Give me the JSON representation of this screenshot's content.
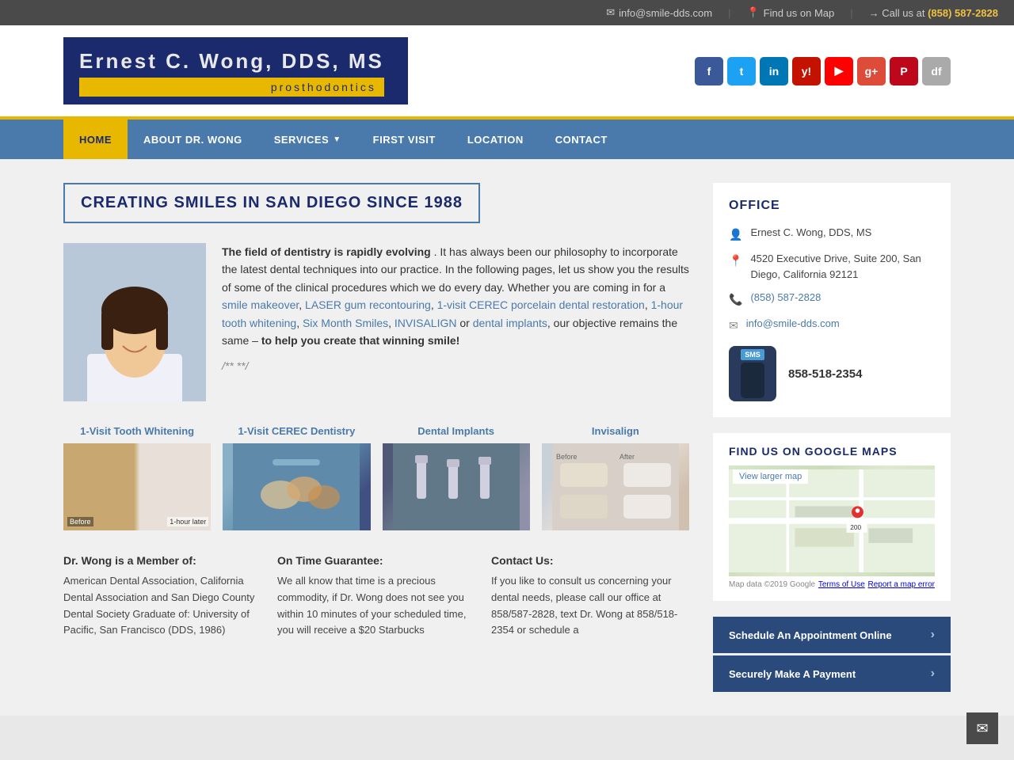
{
  "topbar": {
    "email": "info@smile-dds.com",
    "map_link": "Find us on Map",
    "call_label": "Call us at",
    "phone": "(858) 587-2828"
  },
  "header": {
    "logo_title": "Ernest C. Wong, DDS, MS",
    "logo_subtitle": "prosthodontics",
    "social": [
      {
        "name": "Facebook",
        "abbr": "f",
        "class": "si-fb"
      },
      {
        "name": "Twitter",
        "abbr": "t",
        "class": "si-tw"
      },
      {
        "name": "LinkedIn",
        "abbr": "in",
        "class": "si-li"
      },
      {
        "name": "Yelp",
        "abbr": "y!",
        "class": "si-yelp"
      },
      {
        "name": "YouTube",
        "abbr": "▶",
        "class": "si-yt"
      },
      {
        "name": "Google+",
        "abbr": "g+",
        "class": "si-gplus"
      },
      {
        "name": "Pinterest",
        "abbr": "P",
        "class": "si-pi"
      },
      {
        "name": "Dex",
        "abbr": "df",
        "class": "si-df"
      }
    ]
  },
  "nav": {
    "items": [
      {
        "label": "HOME",
        "active": true
      },
      {
        "label": "ABOUT DR. WONG",
        "active": false
      },
      {
        "label": "SERVICES",
        "active": false,
        "has_arrow": true
      },
      {
        "label": "FIRST VISIT",
        "active": false
      },
      {
        "label": "LOCATION",
        "active": false
      },
      {
        "label": "CONTACT",
        "active": false
      }
    ]
  },
  "main": {
    "page_title": "CREATING SMILES IN SAN DIEGO SINCE 1988",
    "intro_text_bold": "The field of dentistry is rapidly evolving",
    "intro_text": ". It has always been our philosophy to incorporate the latest dental techniques into our practice. In the following pages, let us show you the results of some of the clinical procedures which we do every day. Whether you are coming in for a ",
    "services_links": [
      "smile makeover",
      "LASER gum recontouring",
      "1-visit CEREC porcelain dental restoration",
      "1-hour tooth whitening",
      "Six Month Smiles",
      "INVISALIGN",
      "dental implants"
    ],
    "intro_cta": "to help you create that winning smile!",
    "placeholder_code": "/** **/",
    "services": [
      {
        "title": "1-Visit Tooth Whitening",
        "img_class": "tooth-before-after"
      },
      {
        "title": "1-Visit CEREC Dentistry",
        "img_class": "service-img-cerec"
      },
      {
        "title": "Dental Implants",
        "img_class": "service-img-implants"
      },
      {
        "title": "Invisalign",
        "img_class": "service-img-invisalign"
      }
    ],
    "bottom_cols": [
      {
        "heading": "Dr. Wong is a Member of:",
        "text": "American Dental Association, California Dental Association and San Diego County Dental Society Graduate of: University of Pacific, San Francisco (DDS, 1986)"
      },
      {
        "heading": "On Time Guarantee:",
        "text": "We all know that time is a precious commodity, if Dr. Wong does not see you within 10 minutes of your scheduled time, you will receive a $20 Starbucks"
      },
      {
        "heading": "Contact Us:",
        "text": "If you like to consult us concerning your dental needs, please call our office at 858/587-2828, text Dr. Wong at 858/518-2354 or schedule a"
      }
    ]
  },
  "sidebar": {
    "office_heading": "OFFICE",
    "doctor_name": "Ernest C. Wong, DDS, MS",
    "address": "4520 Executive Drive, Suite 200, San Diego, California 92121",
    "phone": "(858) 587-2828",
    "email": "info@smile-dds.com",
    "sms_number": "858-518-2354",
    "map_heading": "FIND US ON GOOGLE MAPS",
    "map_link_label": "View larger map",
    "map_footer_left": "Map data ©2019 Google",
    "map_footer_center": "Terms of Use",
    "map_footer_right": "Report a map error",
    "cta_buttons": [
      {
        "label": "Schedule An Appointment Online"
      },
      {
        "label": "Securely Make A Payment"
      }
    ]
  }
}
